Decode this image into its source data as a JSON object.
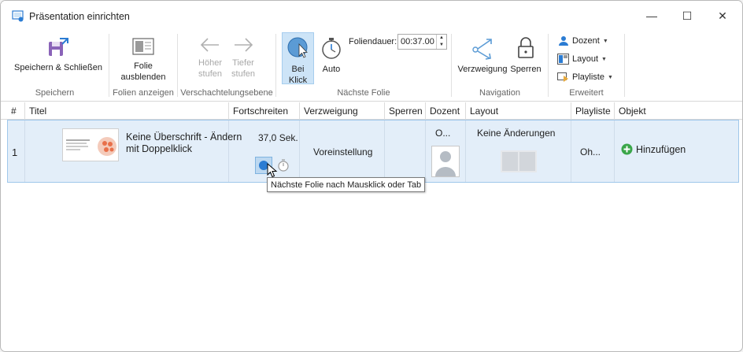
{
  "window": {
    "title": "Präsentation einrichten",
    "minimize": "—",
    "maximize": "☐",
    "close": "✕"
  },
  "ribbon": {
    "speichern": {
      "button": "Speichern & Schließen",
      "group": "Speichern"
    },
    "folien": {
      "button_line1": "Folie",
      "button_line2": "ausblenden",
      "group": "Folien anzeigen"
    },
    "verschachtelung": {
      "hoeher1": "Höher",
      "hoeher2": "stufen",
      "tiefer1": "Tiefer",
      "tiefer2": "stufen",
      "group": "Verschachtelungsebene"
    },
    "naechste": {
      "bei1": "Bei",
      "bei2": "Klick",
      "auto": "Auto",
      "foliendauer_label": "Foliendauer:",
      "foliendauer_value": "00:37.00",
      "group": "Nächste Folie"
    },
    "navigation": {
      "verzweigung": "Verzweigung",
      "sperren": "Sperren",
      "group": "Navigation"
    },
    "erweitert": {
      "dozent": "Dozent",
      "layout": "Layout",
      "playliste": "Playliste",
      "group": "Erweitert"
    }
  },
  "grid": {
    "headers": [
      "#",
      "Titel",
      "Fortschreiten",
      "Verzweigung",
      "Sperren",
      "Dozent",
      "Layout",
      "Playliste",
      "Objekt"
    ],
    "rows": [
      {
        "num": "1",
        "title_line1": "Keine Überschrift - Ändern",
        "title_line2": "mit Doppelklick",
        "fortschreiten": "37,0 Sek.",
        "verzweigung": "Voreinstellung",
        "sperren": "",
        "dozent": "O...",
        "layout": "Keine Änderungen",
        "playliste": "Oh...",
        "objekt": "Hinzufügen"
      }
    ]
  },
  "tooltip": "Nächste Folie nach Mausklick oder Tab",
  "colors": {
    "accent": "#2b7cd3",
    "row_selected": "#e3eef9",
    "add_green": "#3aa64a"
  }
}
